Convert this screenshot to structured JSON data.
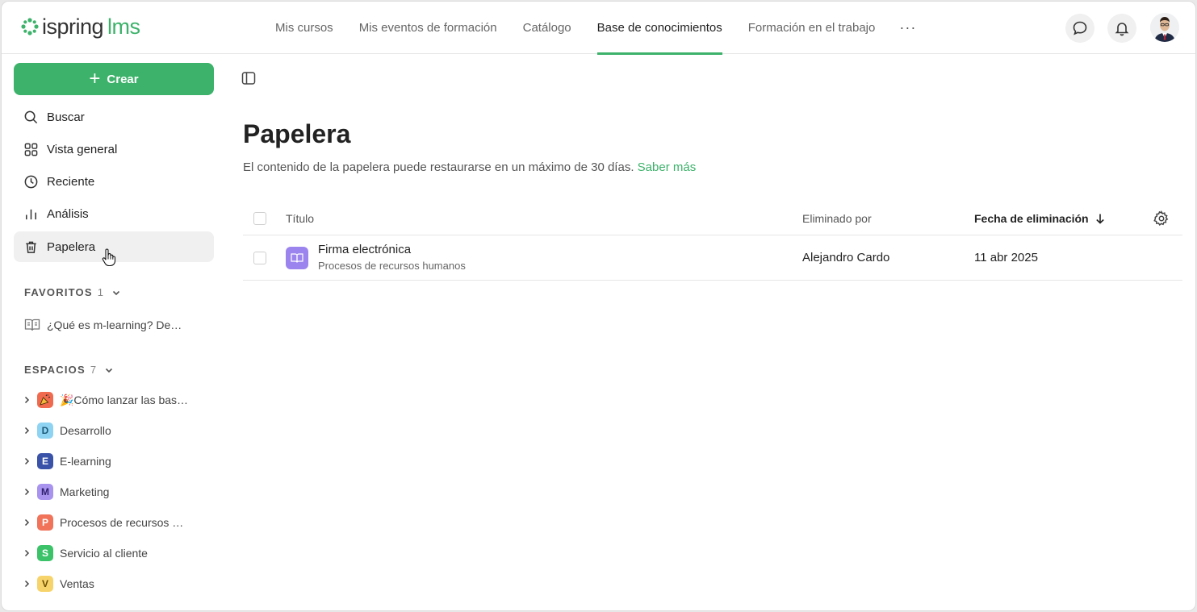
{
  "app": {
    "logo_part1": "ispring",
    "logo_part2": "lms",
    "brand_color": "#3cb26a"
  },
  "nav": {
    "items": [
      "Mis cursos",
      "Mis eventos de formación",
      "Catálogo",
      "Base de conocimientos",
      "Formación en el trabajo"
    ],
    "active": "Base de conocimientos",
    "more_icon": "more-horizontal-icon"
  },
  "header_icons": [
    "chat-icon",
    "bell-icon",
    "avatar"
  ],
  "sidebar": {
    "create_label": "Crear",
    "items": [
      {
        "label": "Buscar",
        "icon": "search-icon"
      },
      {
        "label": "Vista general",
        "icon": "grid-icon"
      },
      {
        "label": "Reciente",
        "icon": "clock-icon"
      },
      {
        "label": "Análisis",
        "icon": "bar-chart-icon"
      },
      {
        "label": "Papelera",
        "icon": "trash-icon",
        "active": true
      }
    ],
    "favorites": {
      "title": "FAVORITOS",
      "count": "1",
      "items": [
        {
          "label": "¿Qué es m-learning? De…",
          "icon": "book-icon"
        }
      ]
    },
    "spaces": {
      "title": "ESPACIOS",
      "count": "7",
      "items": [
        {
          "letter": "🎉",
          "label": "🎉Cómo lanzar las bas…",
          "color": "#f06a4f",
          "text_color": "#fff"
        },
        {
          "letter": "D",
          "label": "Desarrollo",
          "color": "#8fd3f2",
          "text_color": "#1d5a78"
        },
        {
          "letter": "E",
          "label": "E-learning",
          "color": "#3a52a8",
          "text_color": "#fff"
        },
        {
          "letter": "M",
          "label": "Marketing",
          "color": "#a893ef",
          "text_color": "#2e1f6e"
        },
        {
          "letter": "P",
          "label": "Procesos de recursos h…",
          "color": "#f0735a",
          "text_color": "#fff"
        },
        {
          "letter": "S",
          "label": "Servicio al cliente",
          "color": "#3cc36a",
          "text_color": "#fff"
        },
        {
          "letter": "V",
          "label": "Ventas",
          "color": "#f7d46b",
          "text_color": "#6b4e00"
        }
      ]
    }
  },
  "main": {
    "title": "Papelera",
    "description": "El contenido de la papelera puede restaurarse en un máximo de 30 días.",
    "learn_more": "Saber más",
    "table": {
      "columns": {
        "title": "Título",
        "deleted_by": "Eliminado por",
        "deleted_date": "Fecha de eliminación"
      },
      "sort": "descending",
      "rows": [
        {
          "name": "Firma electrónica",
          "space": "Procesos de recursos humanos",
          "deleted_by": "Alejandro Cardo",
          "deleted_date": "11 abr 2025",
          "icon": "book-icon"
        }
      ]
    }
  }
}
